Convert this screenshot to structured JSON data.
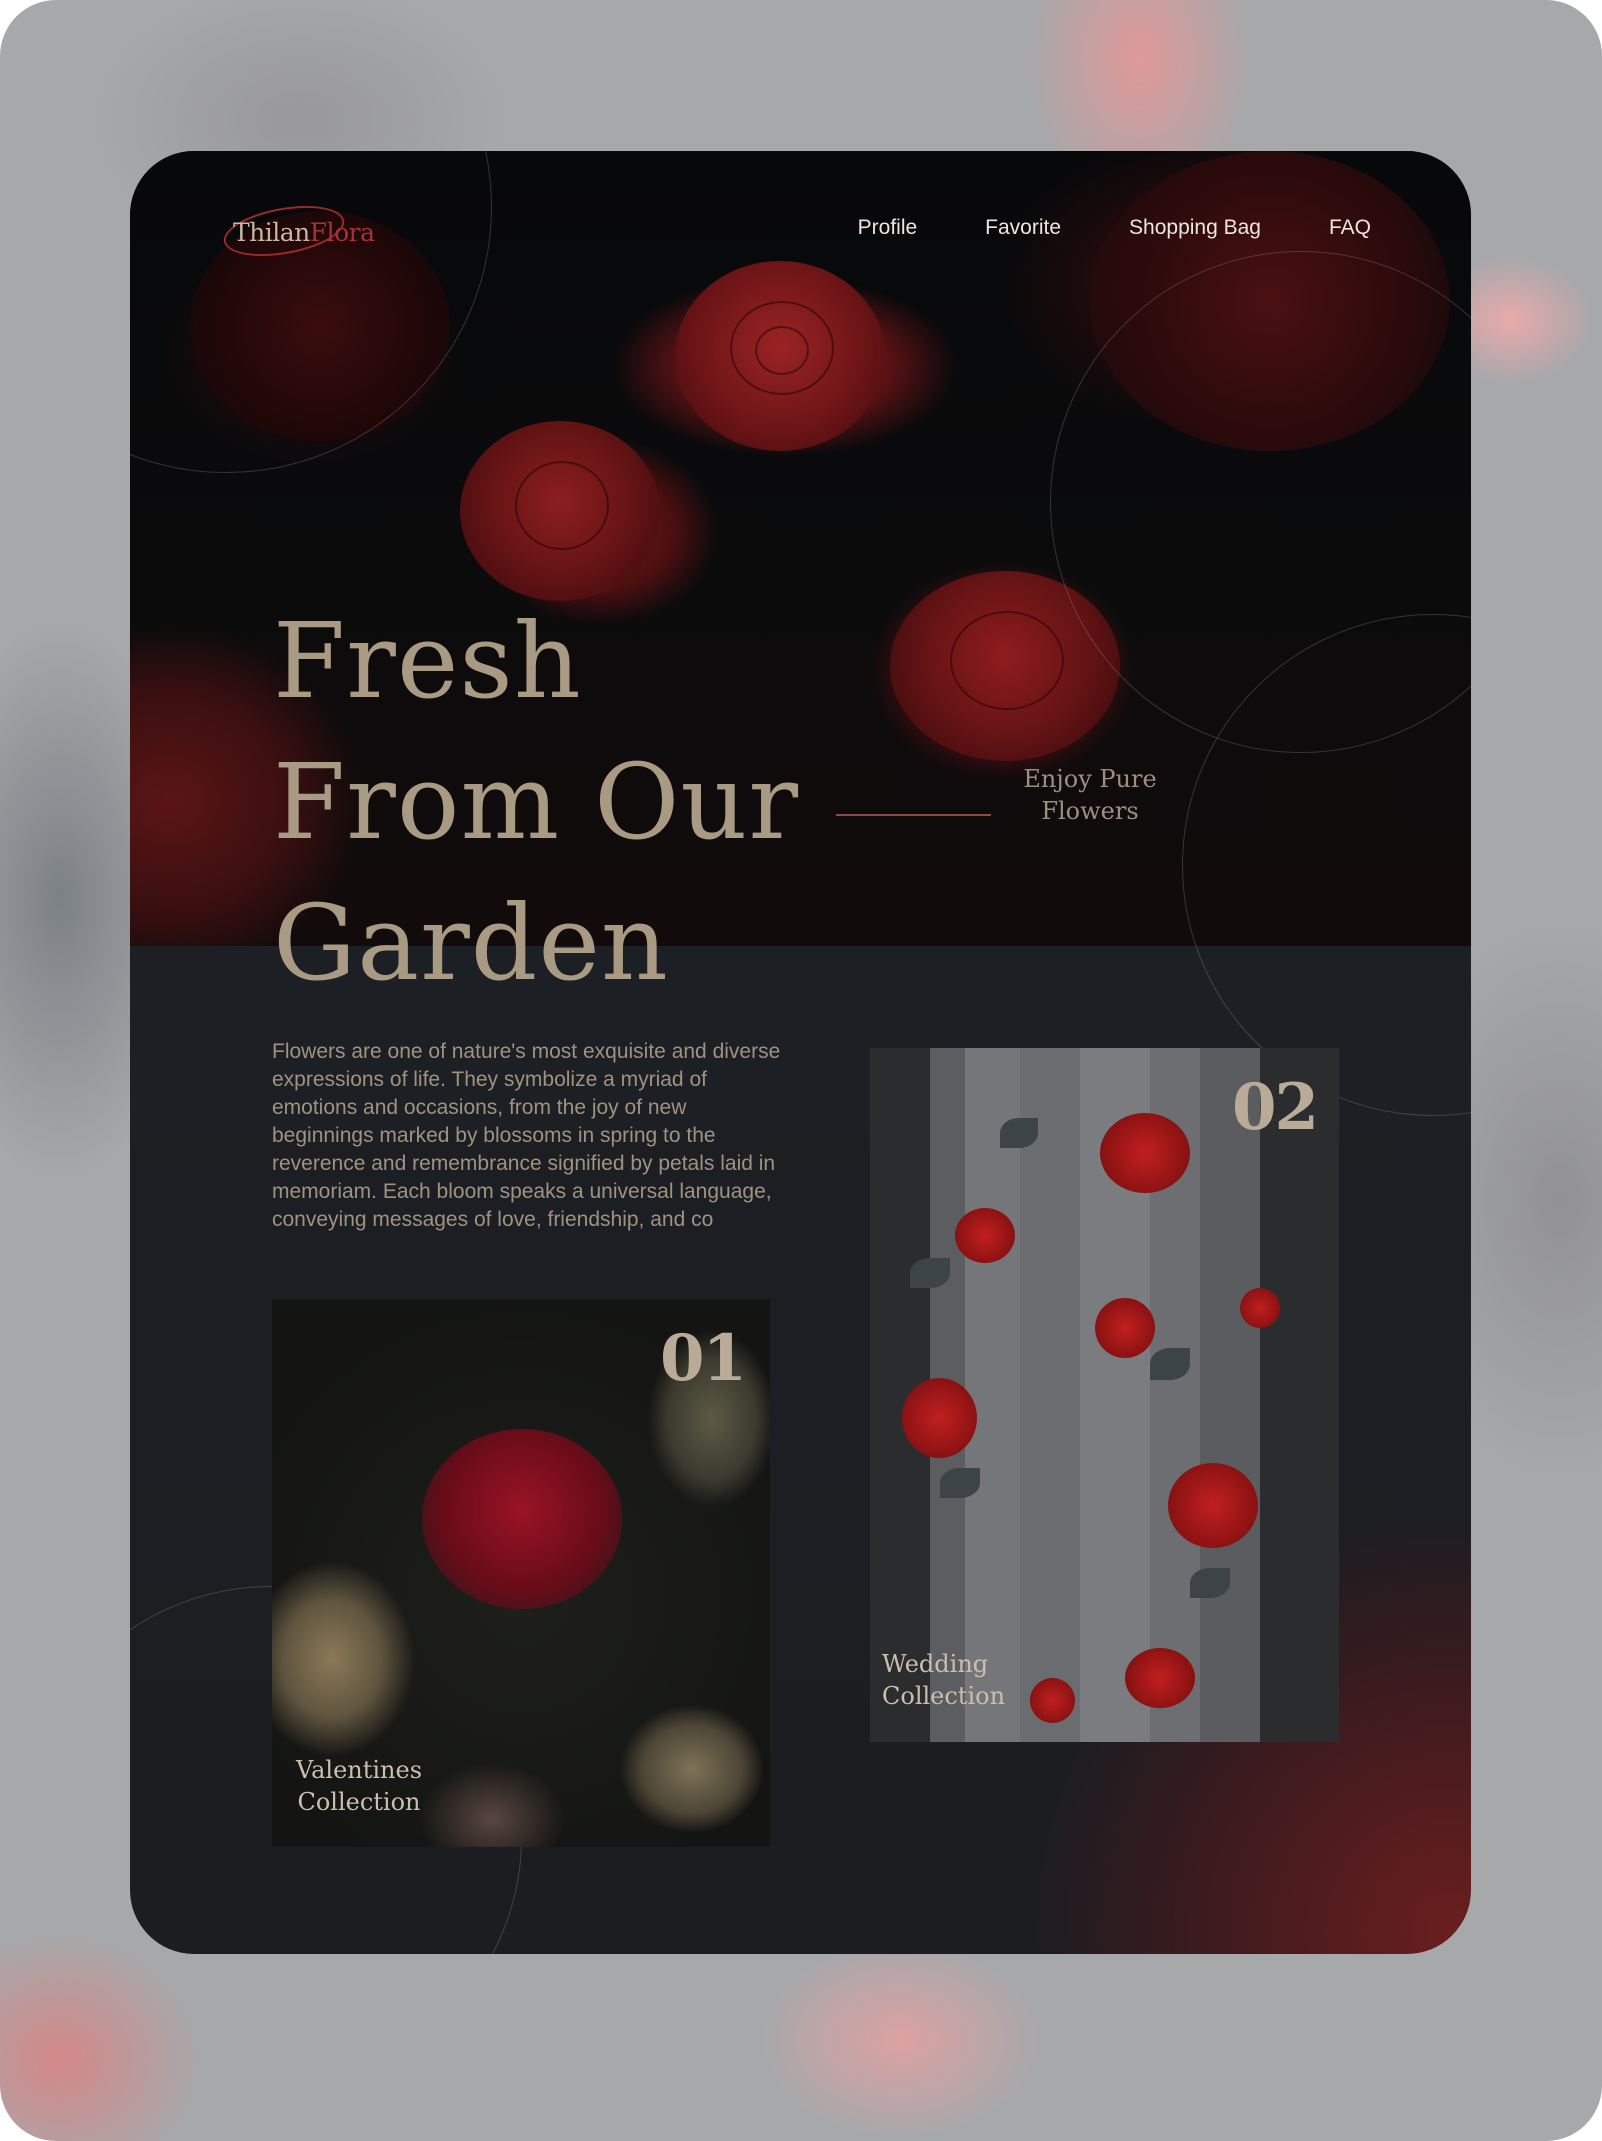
{
  "brand": {
    "logo_part1": "Thilan",
    "logo_part2": "Flora"
  },
  "nav": {
    "items": [
      "Profile",
      "Favorite",
      "Shopping Bag",
      "FAQ"
    ]
  },
  "hero": {
    "headline_lines": [
      "Fresh",
      "From Our",
      "Garden"
    ],
    "tagline_lines": [
      "Enjoy Pure",
      "Flowers"
    ]
  },
  "intro": "Flowers are one of nature's most exquisite and diverse expressions of life. They symbolize a myriad of emotions and occasions, from the joy of new beginnings marked by blossoms in spring to the reverence and remembrance signified by petals laid in memoriam. Each bloom speaks a universal language, conveying messages of love, friendship, and co",
  "collections": [
    {
      "number": "01",
      "label_lines": [
        "Valentines",
        "Collection"
      ]
    },
    {
      "number": "02",
      "label_lines": [
        "Wedding",
        "Collection"
      ]
    }
  ],
  "colors": {
    "accent": "#a43434",
    "headline": "#a99a83",
    "body_text": "#a1927f",
    "card_bg": "#1b1e22"
  }
}
